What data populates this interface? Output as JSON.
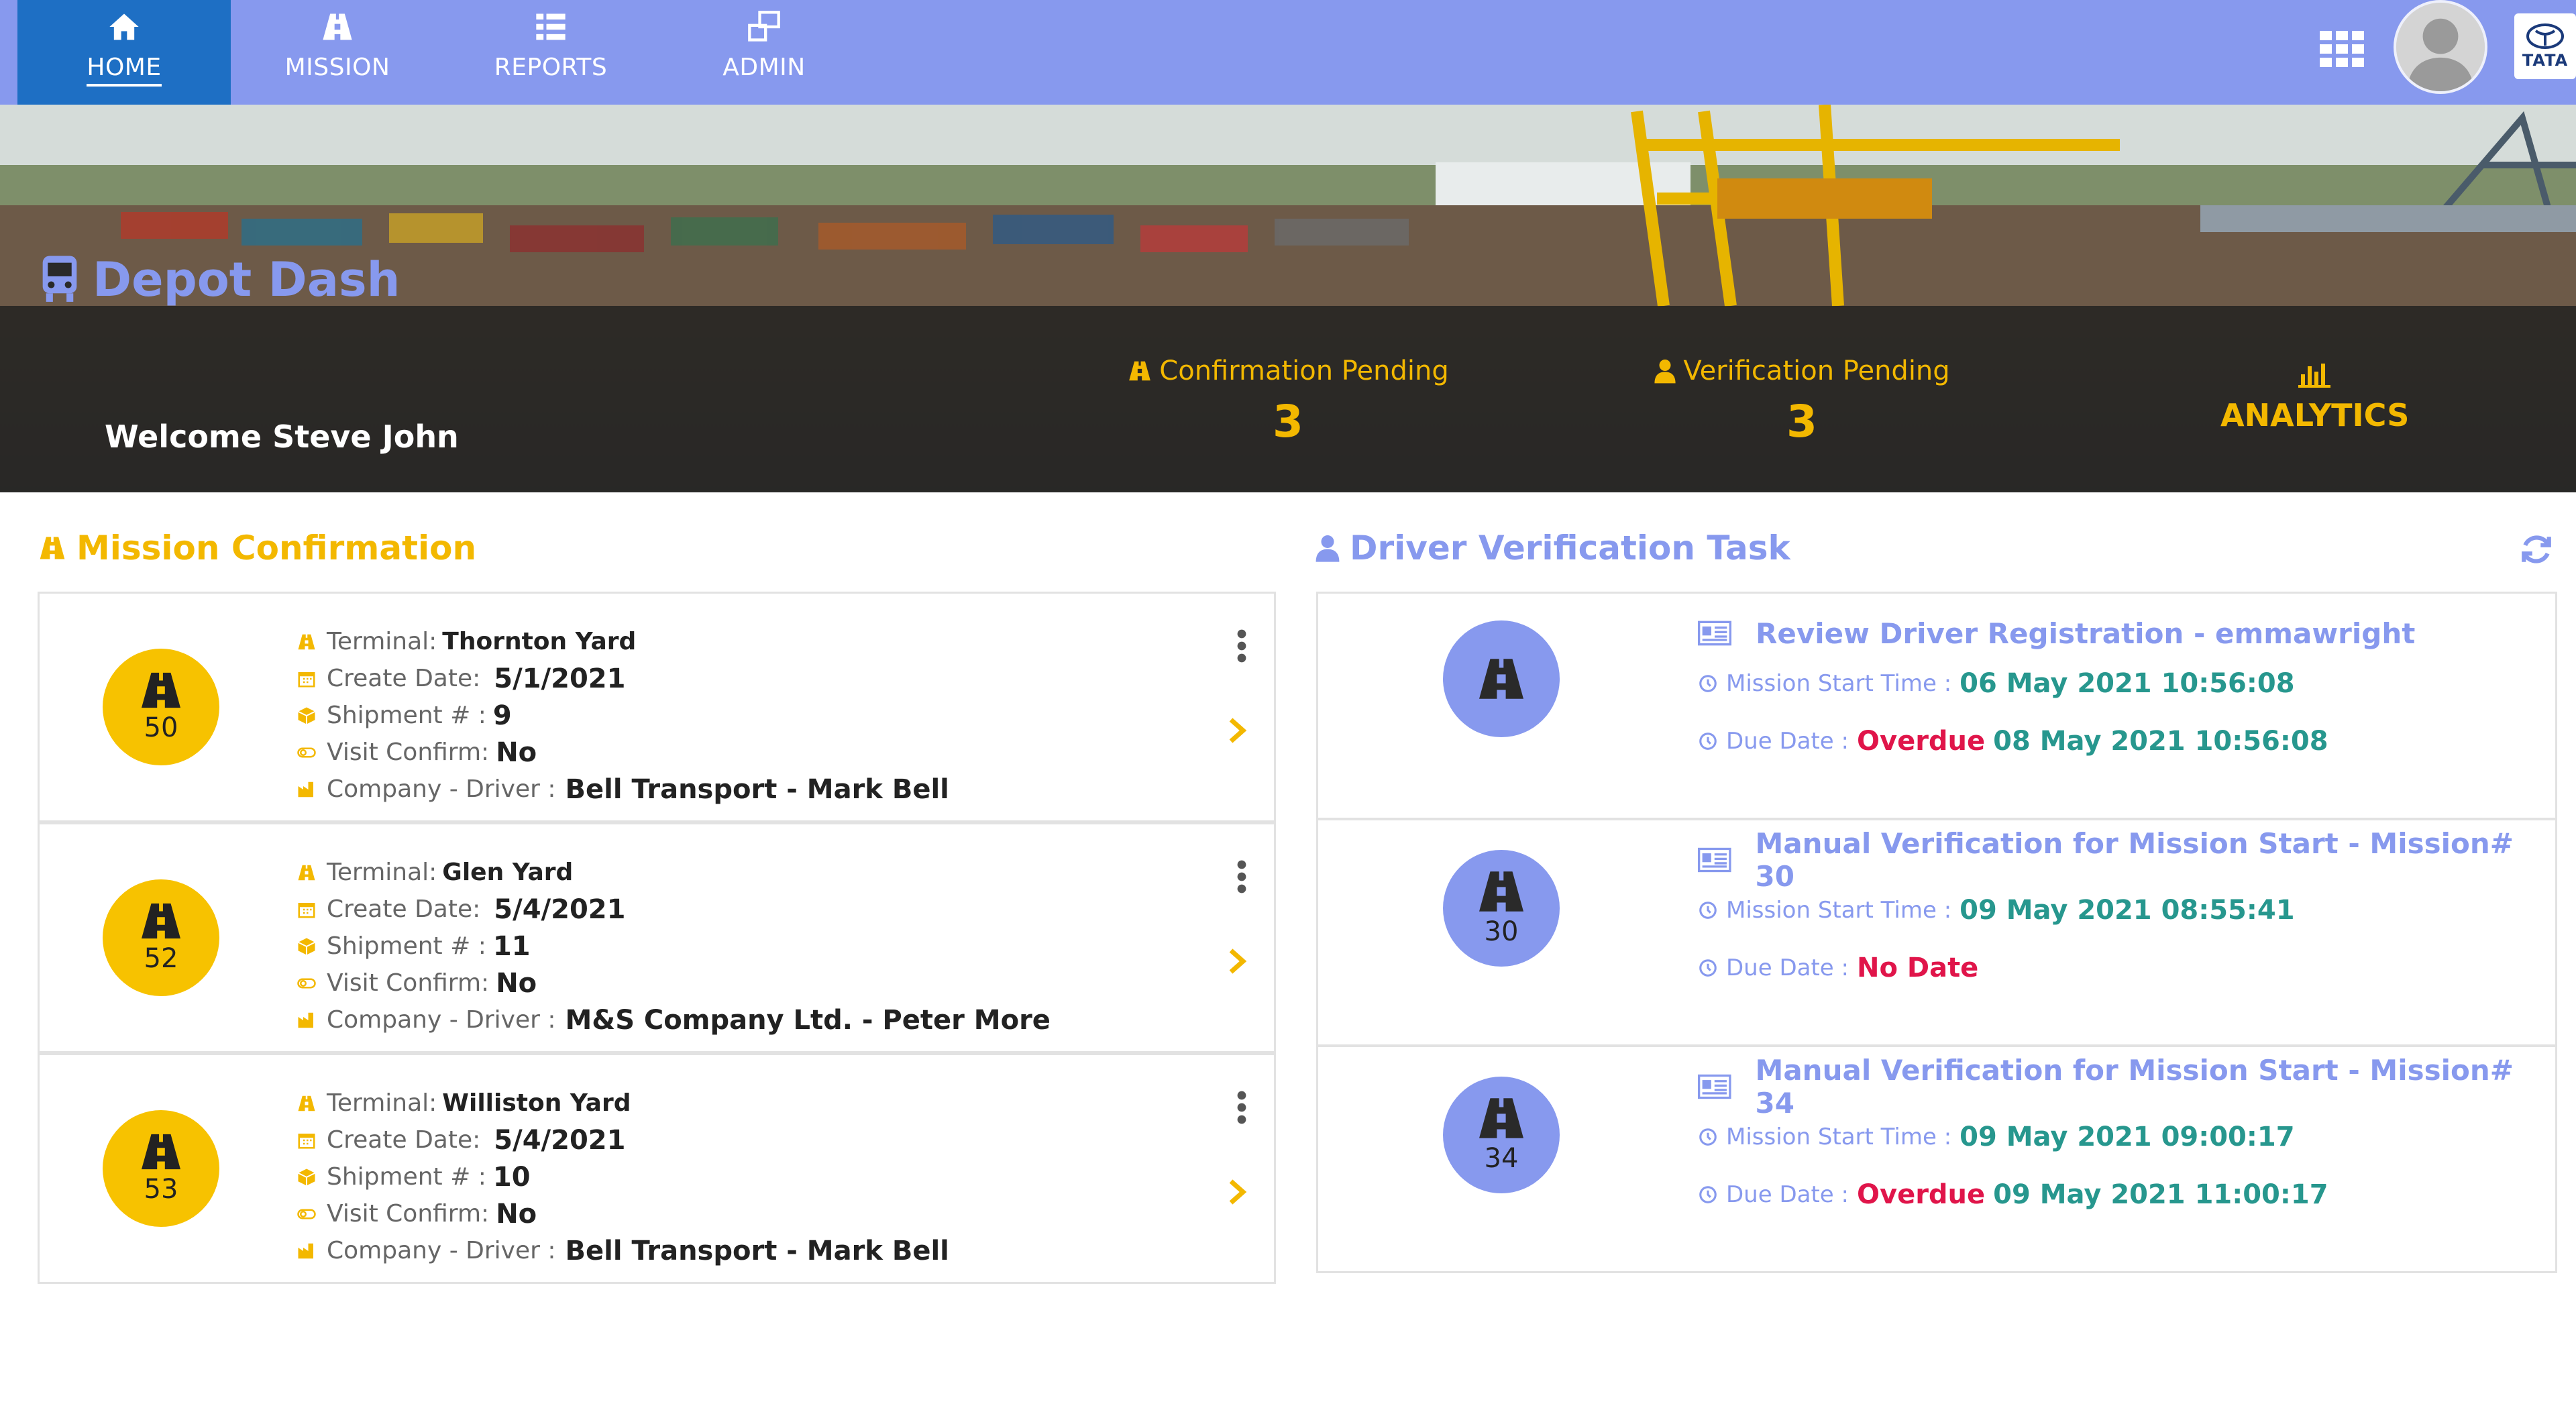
{
  "nav": {
    "items": [
      {
        "label": "HOME",
        "icon": "home-icon"
      },
      {
        "label": "MISSION",
        "icon": "road-icon"
      },
      {
        "label": "REPORTS",
        "icon": "list-icon"
      },
      {
        "label": "ADMIN",
        "icon": "windows-icon"
      }
    ],
    "active": "HOME",
    "brand_logo": "TATA"
  },
  "hero": {
    "app_title": "Depot Dash",
    "welcome": "Welcome Steve John",
    "confirmation": {
      "label": "Confirmation Pending",
      "value": "3"
    },
    "verification": {
      "label": "Verification Pending",
      "value": "3"
    },
    "analytics_label": "ANALYTICS"
  },
  "mission_section": {
    "title": "Mission Confirmation",
    "field_labels": {
      "terminal": "Terminal:",
      "create_date": "Create Date:",
      "shipment": "Shipment # :",
      "visit_confirm": "Visit Confirm:",
      "company_driver": "Company - Driver :"
    },
    "cards": [
      {
        "number": "50",
        "terminal": "Thornton Yard",
        "create_date": "5/1/2021",
        "shipment": "9",
        "visit_confirm": "No",
        "company_driver": "Bell Transport - Mark Bell"
      },
      {
        "number": "52",
        "terminal": "Glen Yard",
        "create_date": "5/4/2021",
        "shipment": "11",
        "visit_confirm": "No",
        "company_driver": "M&S Company Ltd. - Peter More"
      },
      {
        "number": "53",
        "terminal": "Williston Yard",
        "create_date": "5/4/2021",
        "shipment": "10",
        "visit_confirm": "No",
        "company_driver": "Bell Transport - Mark Bell"
      }
    ]
  },
  "driver_section": {
    "title": "Driver Verification Task",
    "start_label": "Mission Start Time :",
    "due_label": "Due Date :",
    "tasks": [
      {
        "number": "",
        "title": "Review Driver Registration - emmawright",
        "start_time": "06 May 2021 10:56:08",
        "due_status": "Overdue",
        "due_value": "08 May 2021 10:56:08"
      },
      {
        "number": "30",
        "title": "Manual Verification for Mission Start - Mission# 30",
        "start_time": "09 May 2021 08:55:41",
        "due_status": "No Date",
        "due_value": ""
      },
      {
        "number": "34",
        "title": "Manual Verification for Mission Start - Mission# 34",
        "start_time": "09 May 2021 09:00:17",
        "due_status": "Overdue",
        "due_value": "09 May 2021 11:00:17"
      }
    ]
  },
  "colors": {
    "nav_bg": "#8799ee",
    "nav_active": "#1e6fc4",
    "accent_yellow": "#f3b800",
    "accent_blue": "#8799ee",
    "teal_value": "#27978e",
    "overdue_red": "#e0154a"
  }
}
